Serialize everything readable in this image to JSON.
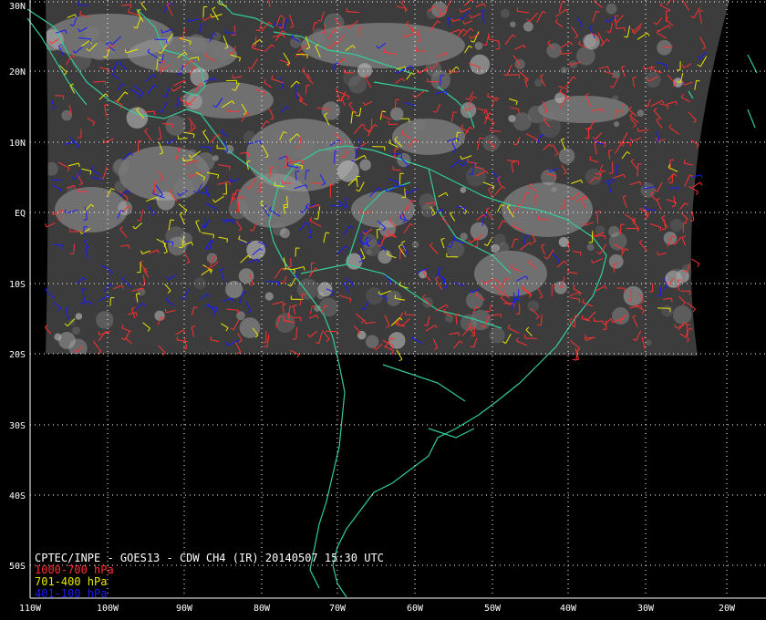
{
  "map": {
    "title": "CPTEC/INPE - GOES13 - CDW CH4 (IR) 20140507 15:30 UTC",
    "lat_labels": [
      "30N",
      "20N",
      "10N",
      "EQ",
      "10S",
      "20S",
      "30S",
      "40S",
      "50S"
    ],
    "lon_labels": [
      "110W",
      "100W",
      "90W",
      "80W",
      "70W",
      "60W",
      "50W",
      "40W",
      "30W",
      "20W"
    ],
    "legend": [
      {
        "label": "1000-700 hPa",
        "color": "#ff3030"
      },
      {
        "label": "701-400 hPa",
        "color": "#e8e800"
      },
      {
        "label": "401-100 hPa",
        "color": "#1a1aff"
      }
    ],
    "coastline_color": "#33cc99",
    "grid_color": "#ffffff",
    "satellite_area": "cloud imagery covering approx. 30N-20S, 105W-20W"
  }
}
